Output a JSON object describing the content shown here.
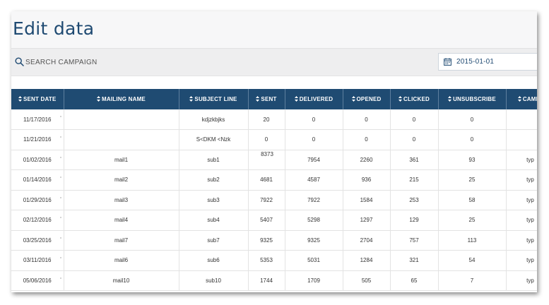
{
  "page": {
    "title": "Edit data"
  },
  "search": {
    "placeholder": "SEARCH CAMPAIGN"
  },
  "date_filter": {
    "value": "2015-01-01"
  },
  "columns": [
    "SENT DATE",
    "MAILING NAME",
    "SUBJECT LINE",
    "SENT",
    "DELIVERED",
    "OPENED",
    "CLICKED",
    "UNSUBSCRIBE",
    "CAMP"
  ],
  "rows": [
    [
      "11/17/2016",
      "",
      "kdjzkbjks",
      "20",
      "0",
      "0",
      "0",
      "0",
      ""
    ],
    [
      "11/21/2016",
      "",
      "S<DKM <Nzk",
      "0",
      "0",
      "0",
      "0",
      "0",
      ""
    ],
    [
      "01/02/2016",
      "mail1",
      "sub1",
      "8373",
      "7954",
      "2260",
      "361",
      "93",
      "typ"
    ],
    [
      "01/14/2016",
      "mail2",
      "sub2",
      "4681",
      "4587",
      "936",
      "215",
      "25",
      "typ"
    ],
    [
      "01/29/2016",
      "mail3",
      "sub3",
      "7922",
      "7922",
      "1584",
      "253",
      "58",
      "typ"
    ],
    [
      "02/12/2016",
      "mail4",
      "sub4",
      "5407",
      "5298",
      "1297",
      "129",
      "25",
      "typ"
    ],
    [
      "03/25/2016",
      "mail7",
      "sub7",
      "9325",
      "9325",
      "2704",
      "757",
      "113",
      "typ"
    ],
    [
      "03/11/2016",
      "mail6",
      "sub6",
      "5353",
      "5031",
      "1284",
      "321",
      "54",
      "typ"
    ],
    [
      "05/06/2016",
      "mail10",
      "sub10",
      "1744",
      "1709",
      "505",
      "65",
      "7",
      "typ"
    ]
  ],
  "editing_cell": {
    "row": 2,
    "col": 3
  },
  "colors": {
    "header_bg": "#1f4b72",
    "title": "#1f4a72",
    "edit_border": "#4a7fc9"
  },
  "icons": {
    "search": "search-icon",
    "calendar": "calendar-icon",
    "sort": "sort-icon"
  }
}
